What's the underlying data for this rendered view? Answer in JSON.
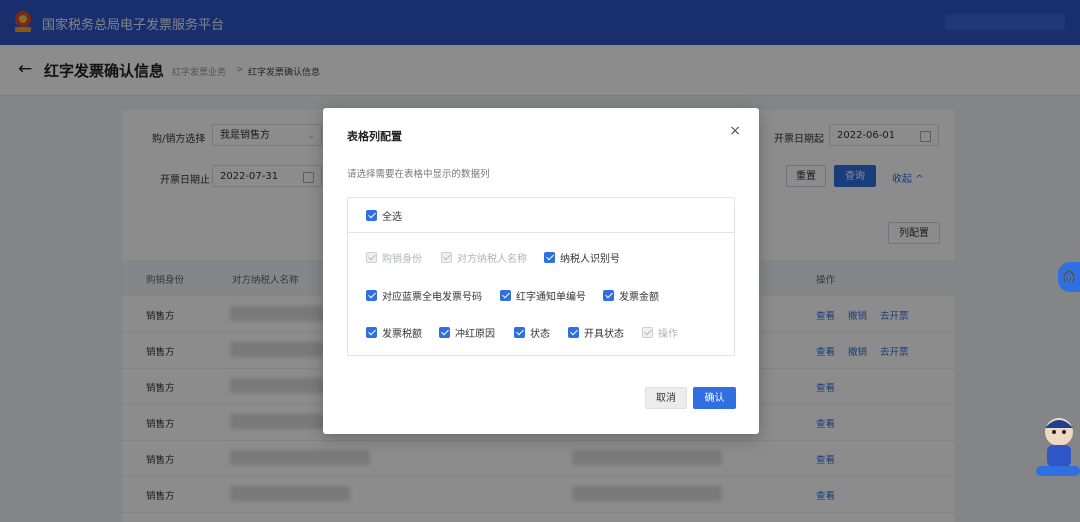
{
  "platform": {
    "title": "国家税务总局电子发票服务平台",
    "emblem_icon": "tax-emblem-icon"
  },
  "header": {
    "title": "红字发票确认信息",
    "breadcrumb": [
      "红字发票业务",
      "红字发票确认信息"
    ],
    "breadcrumb_sep": ">"
  },
  "filters": {
    "party_label": "购/销方选择",
    "party_value": "我是销售方",
    "start_label": "开票日期起",
    "start_value": "2022-06-01",
    "end_label": "开票日期止",
    "end_value": "2022-07-31",
    "reset_label": "重置",
    "query_label": "查询",
    "collapse_label": "收起"
  },
  "table": {
    "column_config_label": "列配置",
    "headers": [
      "购销身份",
      "对方纳税人名称",
      "操作"
    ],
    "rows": [
      {
        "role": "销售方",
        "ops": [
          "查看",
          "撤销",
          "去开票"
        ]
      },
      {
        "role": "销售方",
        "ops": [
          "查看",
          "撤销",
          "去开票"
        ]
      },
      {
        "role": "销售方",
        "ops": [
          "查看"
        ]
      },
      {
        "role": "销售方",
        "ops": [
          "查看"
        ]
      },
      {
        "role": "销售方",
        "ops": [
          "查看"
        ]
      },
      {
        "role": "销售方",
        "ops": [
          "查看"
        ]
      }
    ]
  },
  "modal": {
    "title": "表格列配置",
    "close_icon": "×",
    "description": "请选择需要在表格中显示的数据列",
    "select_all": {
      "label": "全选",
      "checked": true
    },
    "columns": [
      {
        "label": "购销身份",
        "checked": true,
        "disabled": true
      },
      {
        "label": "对方纳税人名称",
        "checked": true,
        "disabled": true
      },
      {
        "label": "纳税人识别号",
        "checked": true,
        "disabled": false
      },
      {
        "label": "对应蓝票全电发票号码",
        "checked": true,
        "disabled": false
      },
      {
        "label": "红字通知单编号",
        "checked": true,
        "disabled": false
      },
      {
        "label": "发票金额",
        "checked": true,
        "disabled": false
      },
      {
        "label": "发票税额",
        "checked": true,
        "disabled": false
      },
      {
        "label": "冲红原因",
        "checked": true,
        "disabled": false
      },
      {
        "label": "状态",
        "checked": true,
        "disabled": false
      },
      {
        "label": "开具状态",
        "checked": true,
        "disabled": false
      },
      {
        "label": "操作",
        "checked": true,
        "disabled": true
      }
    ],
    "cancel_label": "取消",
    "confirm_label": "确认"
  },
  "colors": {
    "brand": "#2f56c7",
    "accent": "#2f6fe0"
  }
}
